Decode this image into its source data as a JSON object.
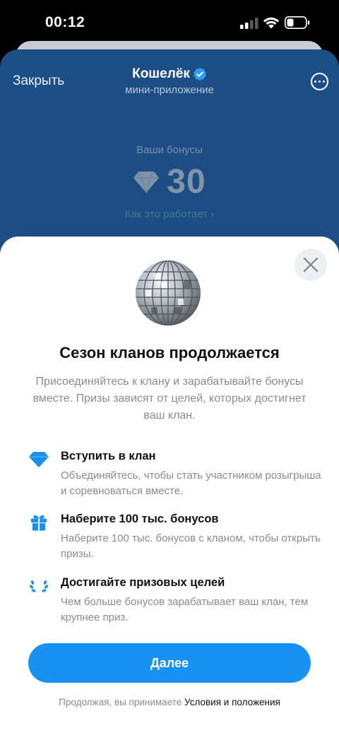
{
  "status_bar": {
    "time": "00:12"
  },
  "app_nav": {
    "close_label": "Закрыть",
    "title": "Кошелёк",
    "subtitle": "мини-приложение"
  },
  "bonuses": {
    "label": "Ваши бонусы",
    "value": "30",
    "how_link": "Как это работает ›"
  },
  "modal": {
    "title": "Сезон кланов продолжается",
    "description": "Присоединяйтесь к клану и зарабатывайте бонусы вместе. Призы зависят от целей, которых достигнет ваш клан.",
    "features": [
      {
        "icon": "diamond-icon",
        "title": "Вступить в клан",
        "desc": "Объединяйтесь, чтобы стать участником розыгрыша и соревноваться вместе."
      },
      {
        "icon": "gift-icon",
        "title": "Наберите 100 тыс. бонусов",
        "desc": "Наберите 100 тыс. бонусов с кланом, чтобы открыть призы."
      },
      {
        "icon": "laurel-icon",
        "title": "Достигайте призовых целей",
        "desc": "Чем больше бонусов зарабатывает ваш клан, тем крупнее приз."
      }
    ],
    "next_button": "Далее",
    "terms_prefix": "Продолжая, вы принимаете",
    "terms_link": "Условия и положения"
  },
  "colors": {
    "accent": "#1792f2",
    "header_bg": "#1c4f86",
    "icon_blue": "#1b8ef0"
  }
}
